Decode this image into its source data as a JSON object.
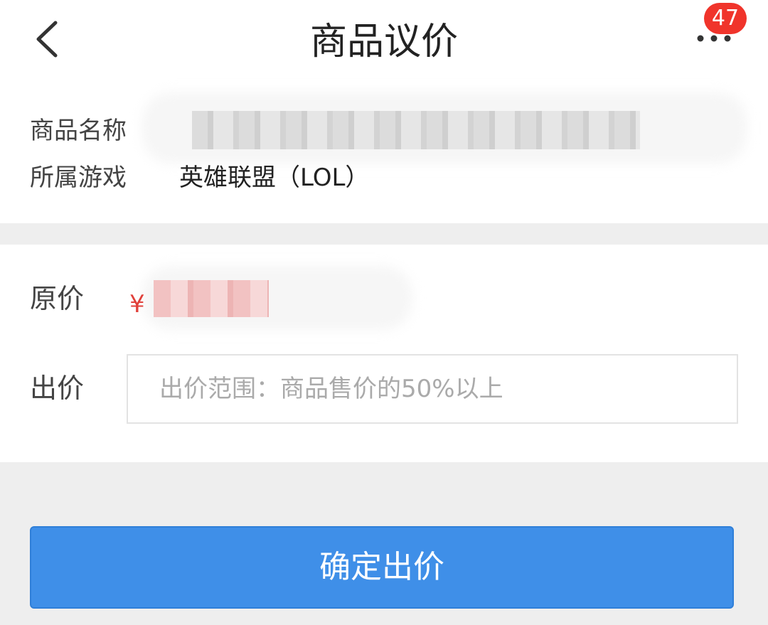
{
  "header": {
    "title": "商品议价",
    "back_icon": "chevron-left-icon",
    "more_icon": "more-dots-icon",
    "badge_count": "47",
    "badge_color": "#f0342b"
  },
  "product_info": {
    "name_label": "商品名称",
    "game_label": "所属游戏",
    "game_value": "英雄联盟（LOL）"
  },
  "price": {
    "original_label": "原价",
    "currency_symbol": "¥",
    "offer_label": "出价",
    "offer_placeholder": "出价范围：商品售价的50%以上",
    "offer_value": ""
  },
  "actions": {
    "confirm_label": "确定出价",
    "confirm_color": "#3f8fe8"
  },
  "colors": {
    "background": "#eeeeee",
    "price_red": "#e0403a"
  }
}
